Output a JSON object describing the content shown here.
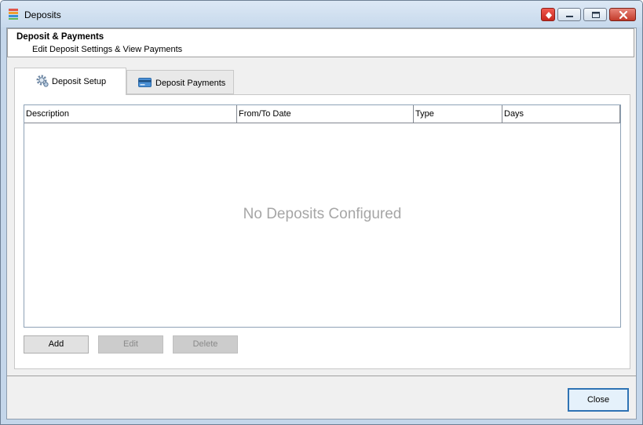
{
  "window": {
    "title": "Deposits",
    "icon": "app-icon"
  },
  "header": {
    "title": "Deposit & Payments",
    "subtitle": "Edit Deposit Settings & View Payments"
  },
  "tabs": [
    {
      "label": "Deposit Setup",
      "icon": "gear-icon",
      "active": true
    },
    {
      "label": "Deposit Payments",
      "icon": "credit-card-icon",
      "active": false
    }
  ],
  "grid": {
    "columns": [
      "Description",
      "From/To Date",
      "Type",
      "Days"
    ],
    "rows": [],
    "empty_message": "No Deposits Configured"
  },
  "actions": {
    "add_label": "Add",
    "edit_label": "Edit",
    "delete_label": "Delete"
  },
  "footer": {
    "close_label": "Close"
  },
  "colors": {
    "accent": "#2f73b4",
    "title_bar": "#c7d9ec",
    "empty_text": "#a6a6a6"
  }
}
